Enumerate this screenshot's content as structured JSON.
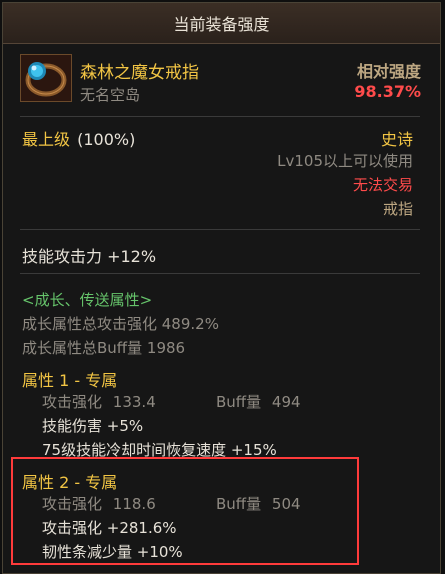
{
  "window": {
    "title": "当前装备强度"
  },
  "item": {
    "name": "森林之魔女戒指",
    "source": "无名空岛",
    "icon": "ring-icon",
    "relative_label": "相对强度",
    "relative_value": "98.37%"
  },
  "grade": {
    "label": "最上级",
    "percent": "(100%)",
    "rarity": "史诗",
    "level_req": "Lv105以上可以使用",
    "trade": "无法交易",
    "type": "戒指"
  },
  "stats": {
    "skill_attack": "技能攻击力 +12%"
  },
  "growth": {
    "header": "<成长、传送属性>",
    "total_attack": "成长属性总攻击强化 489.2%",
    "total_buff": "成长属性总Buff量 1986"
  },
  "attr1": {
    "title": "属性 1 - 专属",
    "attack_label": "攻击强化",
    "attack_value": "133.4",
    "buff_label": "Buff量",
    "buff_value": "494",
    "effect1": "技能伤害 +5%",
    "effect2": "75级技能冷却时间恢复速度 +15%"
  },
  "attr2": {
    "title": "属性 2 - 专属",
    "attack_label": "攻击强化",
    "attack_value": "118.6",
    "buff_label": "Buff量",
    "buff_value": "504",
    "effect1": "攻击强化 +281.6%",
    "effect2": "韧性条减少量 +10%"
  },
  "colors": {
    "gold": "#f2c544",
    "red": "#ff4b4b",
    "green": "#66c46b",
    "highlight": "#ff3b3b"
  }
}
